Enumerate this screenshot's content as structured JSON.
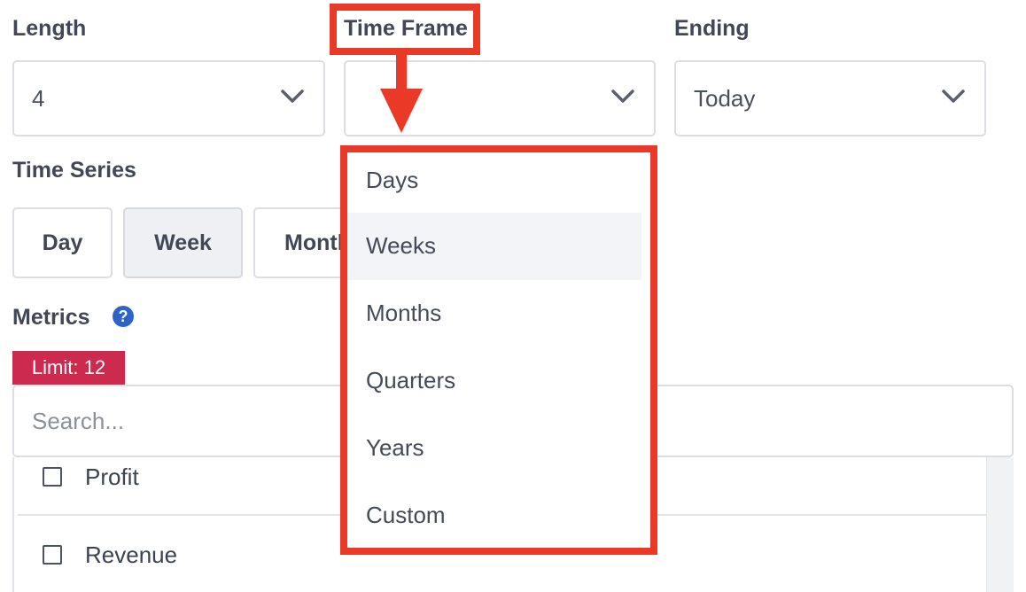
{
  "length": {
    "label": "Length",
    "value": "4"
  },
  "time_frame": {
    "label": "Time Frame",
    "value": ""
  },
  "ending": {
    "label": "Ending",
    "value": "Today"
  },
  "time_series": {
    "label": "Time Series",
    "options": [
      "Day",
      "Week",
      "Month"
    ],
    "selected": "Week"
  },
  "metrics": {
    "label": "Metrics",
    "help_icon": "question-circle-icon",
    "help_glyph": "?",
    "limit": "Limit: 12",
    "search_placeholder": "Search...",
    "items": [
      "Profit",
      "Revenue"
    ]
  },
  "time_frame_dropdown": {
    "options": [
      "Days",
      "Weeks",
      "Months",
      "Quarters",
      "Years",
      "Custom"
    ],
    "highlighted": "Weeks"
  },
  "colors": {
    "annotation": "#ea3a27",
    "limit_badge": "#cc2b4f",
    "help_icon": "#2f63c7"
  }
}
